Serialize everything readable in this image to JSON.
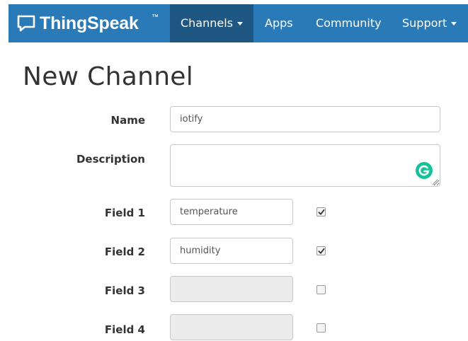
{
  "navbar": {
    "brand": "ThingSpeak",
    "brand_tm": "™",
    "items": [
      {
        "label": "Channels",
        "active": true,
        "dropdown": true
      },
      {
        "label": "Apps",
        "active": false,
        "dropdown": false
      },
      {
        "label": "Community",
        "active": false,
        "dropdown": false
      },
      {
        "label": "Support",
        "active": false,
        "dropdown": true
      }
    ]
  },
  "page": {
    "title": "New Channel"
  },
  "form": {
    "name": {
      "label": "Name",
      "value": "iotify"
    },
    "description": {
      "label": "Description",
      "value": ""
    },
    "fields": [
      {
        "label": "Field 1",
        "value": "temperature",
        "checked": true,
        "enabled": true
      },
      {
        "label": "Field 2",
        "value": "humidity",
        "checked": true,
        "enabled": true
      },
      {
        "label": "Field 3",
        "value": "",
        "checked": false,
        "enabled": false
      },
      {
        "label": "Field 4",
        "value": "",
        "checked": false,
        "enabled": false
      }
    ]
  },
  "colors": {
    "navbar_bg": "#2a7ab8",
    "navbar_active_bg": "#1e5882",
    "grammarly_green": "#15c39a"
  },
  "icons": {
    "brand": "speech-bubble-icon",
    "grammarly": "grammarly-icon",
    "checkmark": "checkmark-icon",
    "resize": "resize-grip-icon"
  }
}
